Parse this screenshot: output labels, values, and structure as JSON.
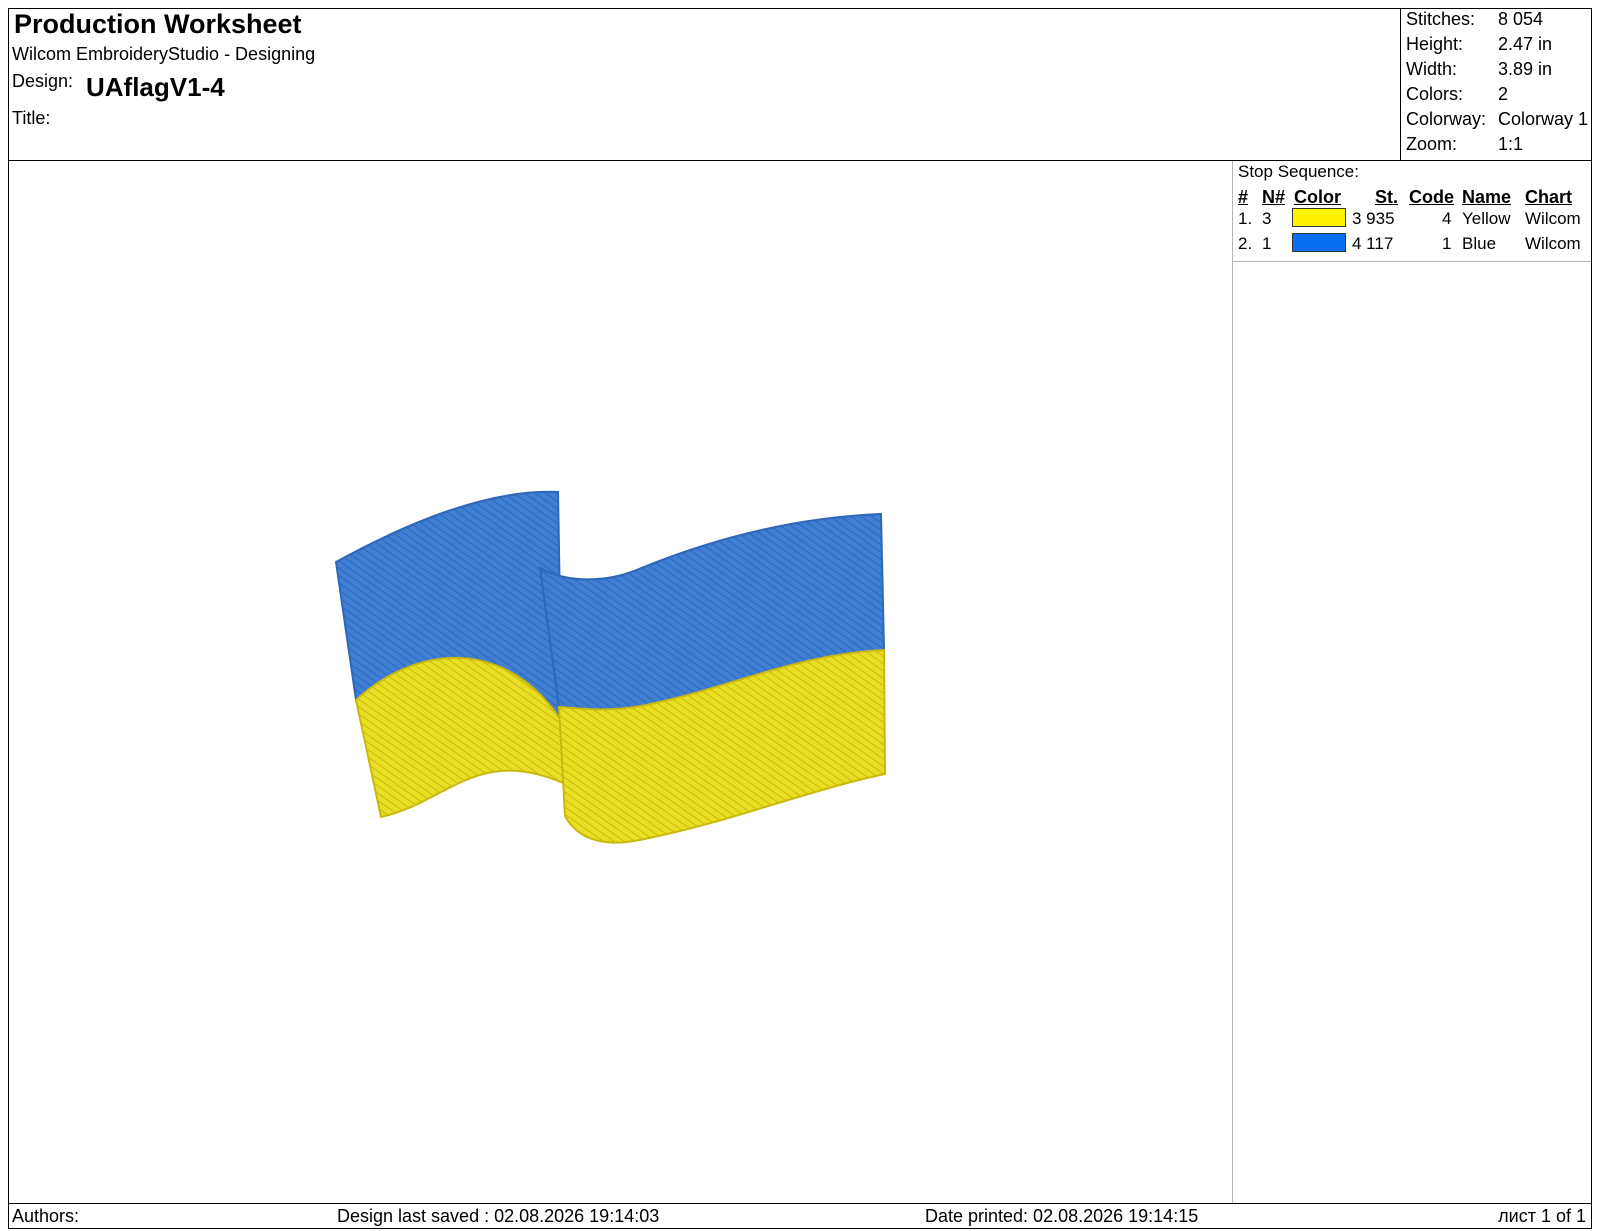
{
  "header": {
    "title": "Production Worksheet",
    "application": "Wilcom EmbroideryStudio - Designing",
    "design_label": "Design:",
    "design_name": "UAflagV1-4",
    "title_label": "Title:"
  },
  "stats": [
    {
      "label": "Stitches:",
      "value": "8 054"
    },
    {
      "label": "Height:",
      "value": "2.47 in"
    },
    {
      "label": "Width:",
      "value": "3.89 in"
    },
    {
      "label": "Colors:",
      "value": "2"
    },
    {
      "label": "Colorway:",
      "value": "Colorway 1"
    },
    {
      "label": "Zoom:",
      "value": "1:1"
    }
  ],
  "stop_sequence": {
    "title": "Stop Sequence:",
    "columns": [
      "#",
      "N#",
      "Color",
      "St.",
      "Code",
      "Name",
      "Chart"
    ],
    "rows": [
      {
        "index": "1.",
        "needle": "3",
        "color": "#fff200",
        "stitches": "3 935",
        "code": "4",
        "name": "Yellow",
        "chart": "Wilcom"
      },
      {
        "index": "2.",
        "needle": "1",
        "color": "#0a6ef0",
        "stitches": "4 117",
        "code": "1",
        "name": "Blue",
        "chart": "Wilcom"
      }
    ]
  },
  "design_colors": {
    "blue": "#3f7fd4",
    "yellow": "#e9df22"
  },
  "footer": {
    "authors_label": "Authors:",
    "last_saved": "Design last saved : 02.08.2026 19:14:03",
    "date_printed": "Date printed: 02.08.2026 19:14:15",
    "page": "лист 1 of 1"
  }
}
